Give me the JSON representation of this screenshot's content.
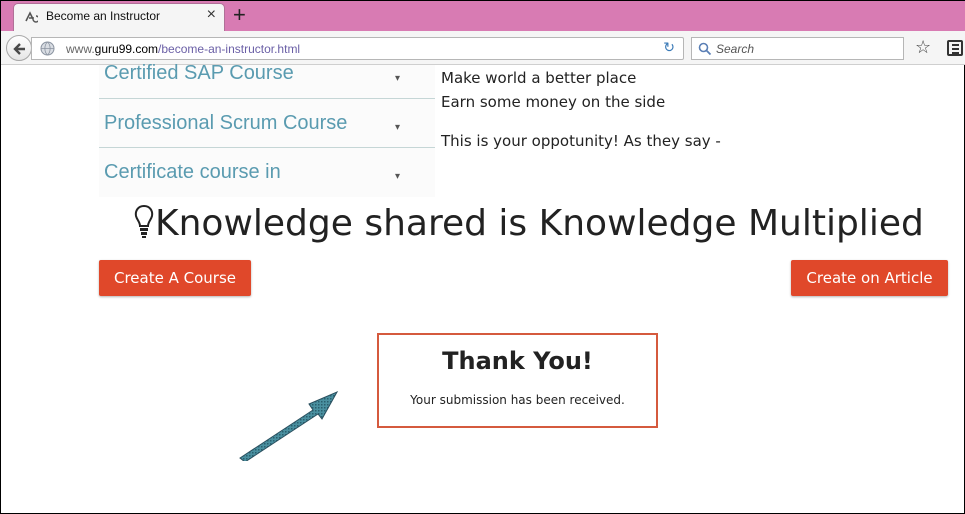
{
  "browser": {
    "tab_title": "Become an Instructor",
    "tab_close": "×",
    "new_tab": "+",
    "url_prefix": "www.",
    "url_domain": "guru99.com",
    "url_path": "/become-an-instructor.html",
    "search_placeholder": "Search",
    "reload_glyph": "↻",
    "bookmark_glyph": "☆",
    "accent_color": "#d87bb3"
  },
  "courses": [
    {
      "label": "Certified SAP Course",
      "icon": "chevron-down-icon"
    },
    {
      "label": "Professional Scrum Course",
      "icon": "chevron-down-icon"
    },
    {
      "label": "Certificate course in",
      "icon": "chevron-down-icon"
    }
  ],
  "side_lines": [
    "Make world a better place",
    "Earn some money on the side",
    "This is your oppotunity! As they say -"
  ],
  "headline": "Knowledge shared is Knowledge Multiplied",
  "buttons": {
    "create_course": "Create A Course",
    "create_article": "Create on Article",
    "color": "#e0482a"
  },
  "thank_you": {
    "title": "Thank You!",
    "message": "Your submission has been received."
  }
}
